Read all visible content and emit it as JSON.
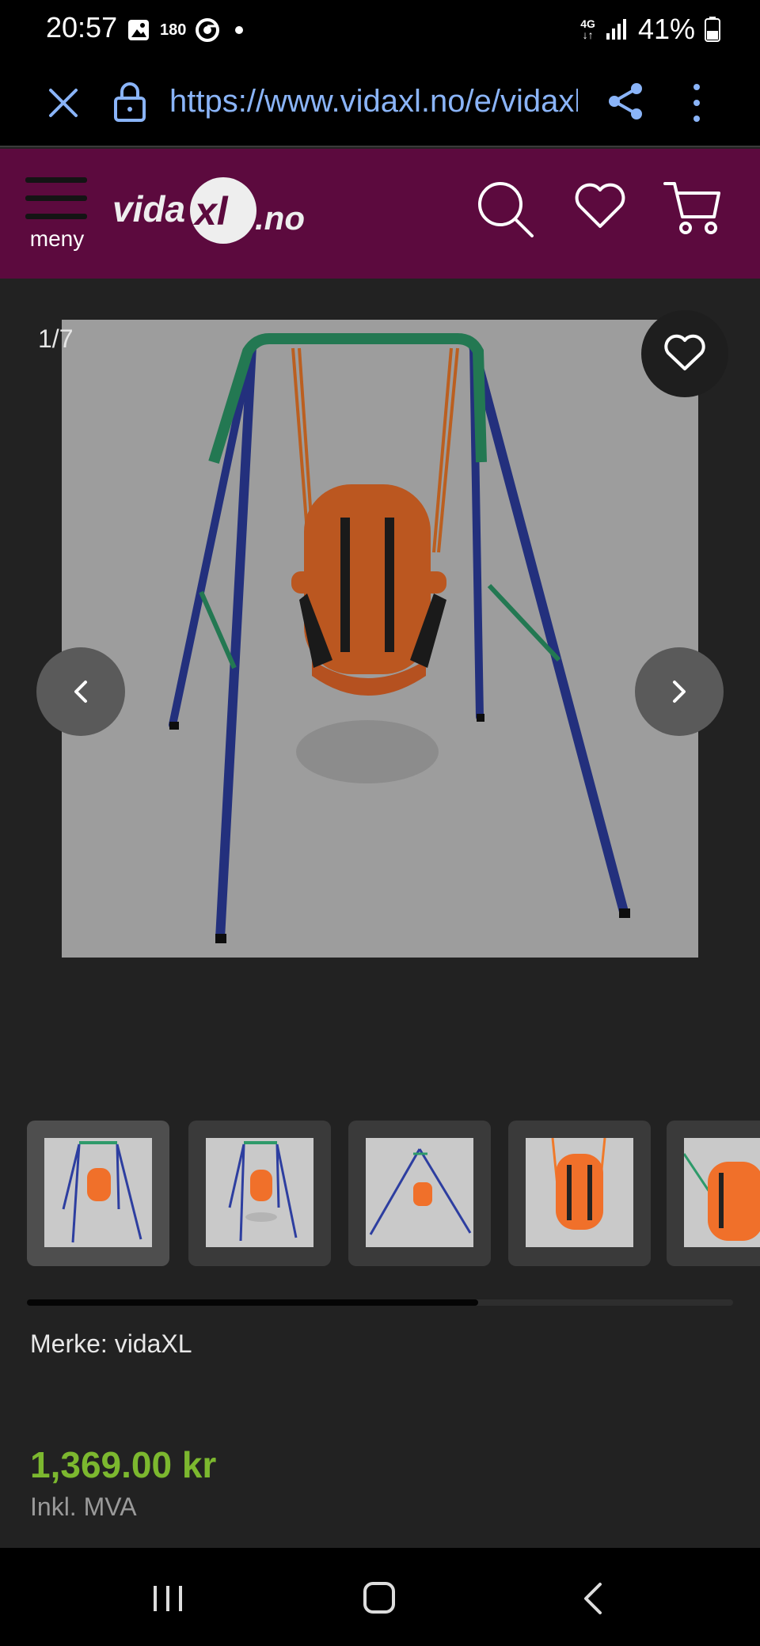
{
  "status_bar": {
    "time": "20:57",
    "notification_count": "180",
    "network": "4G",
    "battery": "41%"
  },
  "browser": {
    "url": "https://www.vidaxl.no/e/vidaxl-toddler-swing"
  },
  "site_header": {
    "menu_label": "meny",
    "logo_text": "vidaXL.no"
  },
  "gallery": {
    "counter": "1/7",
    "thumbnails": [
      {
        "icon": "swing-front"
      },
      {
        "icon": "swing-front-shadow"
      },
      {
        "icon": "swing-side"
      },
      {
        "icon": "swing-seat-closeup"
      },
      {
        "icon": "swing-seat-angle"
      }
    ],
    "scroll_progress": 0.64
  },
  "product": {
    "brand": "Merke: vidaXL",
    "price": "1,369.00 kr",
    "vat_note": "Inkl. MVA"
  },
  "colors": {
    "header_bg": "#5c0a3e",
    "price": "#7cb82f",
    "url": "#8ab4f8"
  }
}
